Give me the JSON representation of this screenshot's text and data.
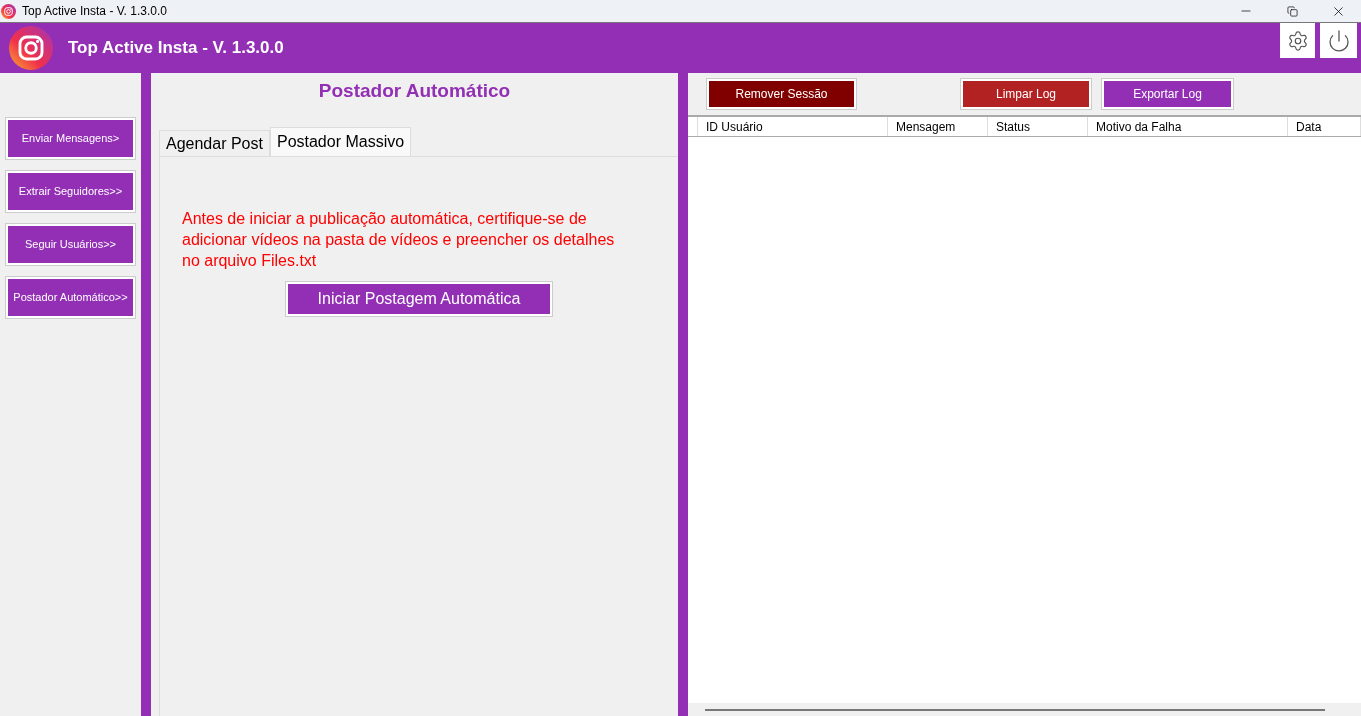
{
  "window": {
    "title": "Top Active Insta - V. 1.3.0.0"
  },
  "header": {
    "title": "Top Active Insta - V. 1.3.0.0"
  },
  "sidebar": {
    "items": [
      {
        "label": "Enviar Mensagens>"
      },
      {
        "label": "Extrair Seguidores>>"
      },
      {
        "label": "Seguir Usuários>>"
      },
      {
        "label": "Postador Automático>>"
      }
    ]
  },
  "main": {
    "title": "Postador Automático",
    "tabs": [
      {
        "label": "Agendar Post",
        "selected": false
      },
      {
        "label": "Postador Massivo",
        "selected": true
      }
    ],
    "notice": "Antes de iniciar a publicação automática, certifique-se de adicionar vídeos na pasta de vídeos e preencher os detalhes no arquivo Files.txt",
    "start_button": "Iniciar Postagem Automática"
  },
  "log": {
    "buttons": [
      {
        "label": "Remover Sessão",
        "color": "#800000"
      },
      {
        "label": "Limpar Log",
        "color": "#b22222"
      },
      {
        "label": "Exportar Log",
        "color": "#922fb5"
      }
    ],
    "columns": [
      "ID Usuário",
      "Mensagem",
      "Status",
      "Motivo da Falha",
      "Data"
    ]
  }
}
